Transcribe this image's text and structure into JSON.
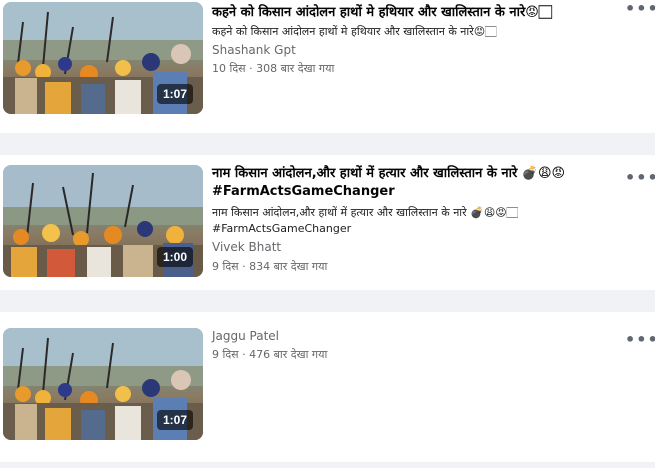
{
  "videos": [
    {
      "title": "कहने को किसान आंदोलन हाथों मे हथियार और खालिस्तान के नारे😡🏻",
      "description": "कहने को किसान आंदोलन हाथों मे हथियार और खालिस्तान के नारे😡🏻",
      "author": "Shashank Gpt",
      "meta": "10 दिस · 308 बार देखा गया",
      "duration": "1:07",
      "more_icon": "more-options-icon"
    },
    {
      "title": "नाम किसान आंदोलन,और हाथों में हत्यार और खालिस्तान के नारे 💣😩😡#FarmActsGameChanger",
      "description": "नाम किसान आंदोलन,और हाथों में हत्यार और खालिस्तान के नारे 💣😩😡🏻 #FarmActsGameChanger",
      "author": "Vivek Bhatt",
      "meta": "9 दिस · 834 बार देखा गया",
      "duration": "1:00",
      "more_icon": "more-options-icon"
    },
    {
      "title": "",
      "description": "",
      "author": "Jaggu Patel",
      "meta": "9 दिस · 476 बार देखा गया",
      "duration": "1:07",
      "more_icon": "more-options-icon"
    }
  ],
  "colors": {
    "page_background": "#f0f2f5",
    "card_background": "#ffffff",
    "secondary_text": "#65676b",
    "duration_badge": "rgba(0,0,0,0.6)"
  }
}
